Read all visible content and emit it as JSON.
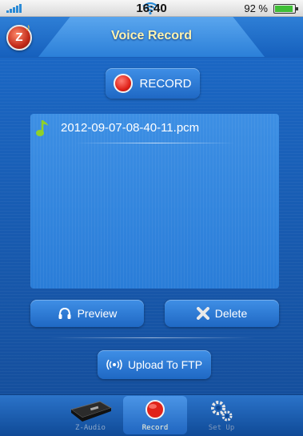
{
  "status_bar": {
    "time": "16:40",
    "battery_text": "92 %",
    "battery_level": 0.92
  },
  "header": {
    "title": "Voice Record",
    "logo_letter": "Z"
  },
  "record_button": {
    "label": "RECORD",
    "icon": "red-dot-icon"
  },
  "recordings": [
    {
      "name": "2012-09-07-08-40-11.pcm",
      "icon": "music-note-icon"
    }
  ],
  "actions": {
    "preview_label": "Preview",
    "delete_label": "Delete",
    "upload_label": "Upload To FTP"
  },
  "tabs": [
    {
      "label": "Z-Audio",
      "icon": "device-icon",
      "active": false
    },
    {
      "label": "Record",
      "icon": "record-icon",
      "active": true
    },
    {
      "label": "Set Up",
      "icon": "gears-icon",
      "active": false
    }
  ],
  "colors": {
    "primary_blue": "#1b67c4",
    "record_red": "#e0231a",
    "accent_yellow": "#fff3b0"
  }
}
